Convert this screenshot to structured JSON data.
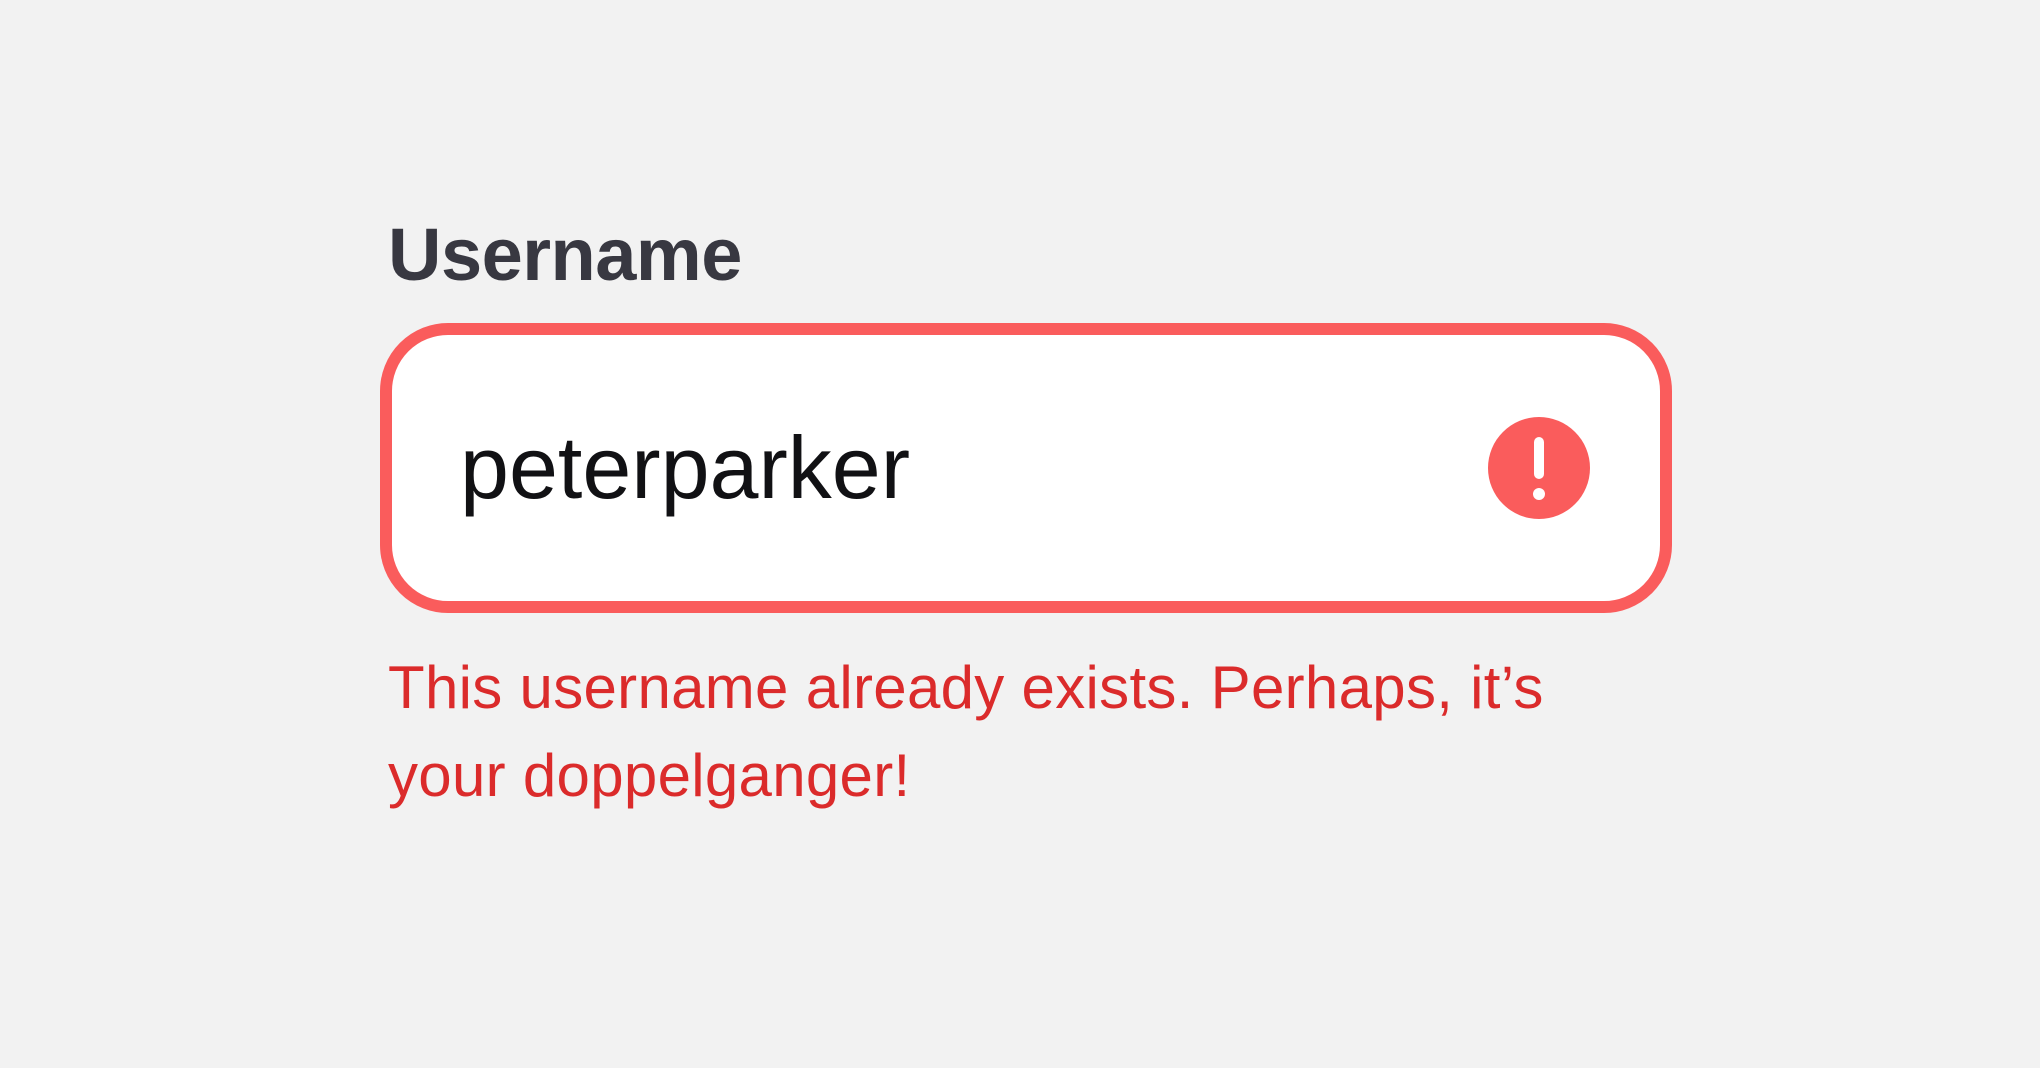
{
  "form": {
    "username": {
      "label": "Username",
      "value": "peterparker",
      "icon": "alert-circle-icon",
      "error_message": "This username already exists. Perhaps, it’s your doppelganger!",
      "state": "error"
    }
  },
  "colors": {
    "background": "#f2f2f2",
    "label_text": "#383841",
    "input_border_error": "#fa5c5c",
    "input_background": "#ffffff",
    "input_text": "#111114",
    "error_icon": "#fa5c5c",
    "error_text": "#db2b2b"
  }
}
